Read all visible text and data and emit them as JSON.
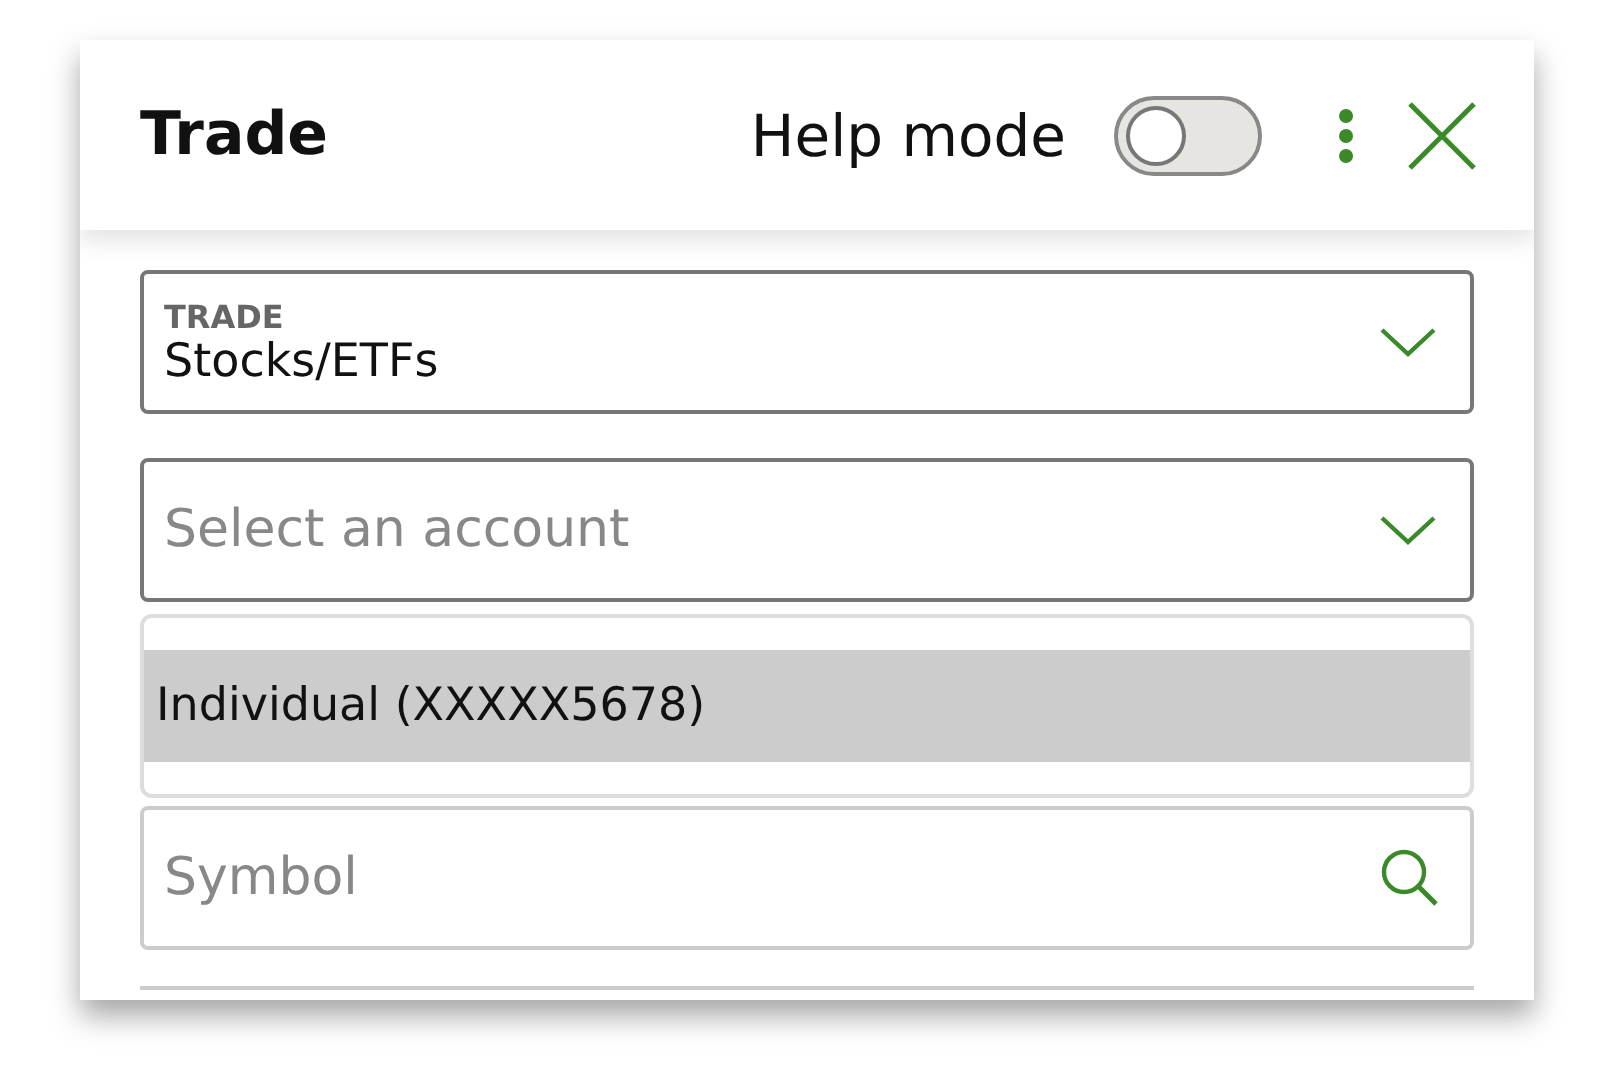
{
  "header": {
    "title": "Trade",
    "help_mode": {
      "label": "Help mode",
      "on": false
    }
  },
  "trade_select": {
    "label": "TRADE",
    "value": "Stocks/ETFs"
  },
  "account_select": {
    "placeholder": "Select an account"
  },
  "account_options": [
    {
      "label": "Individual (XXXXX5678)",
      "selected": true
    }
  ],
  "symbol": {
    "placeholder": "Symbol"
  }
}
